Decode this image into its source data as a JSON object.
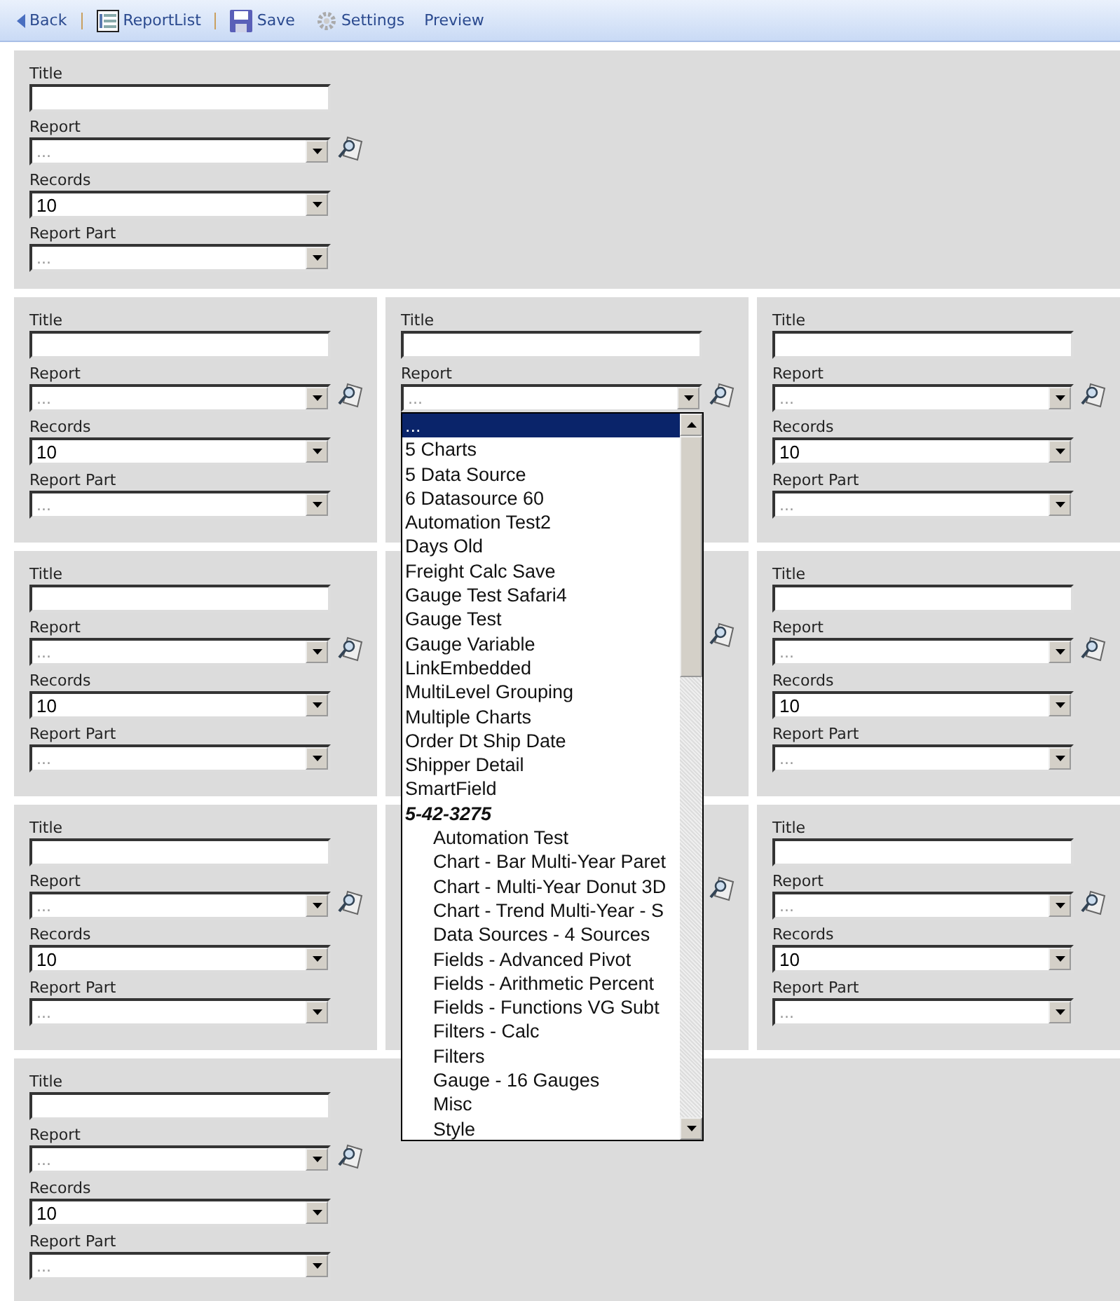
{
  "toolbar": [
    {
      "kind": "back",
      "label": "Back"
    },
    {
      "kind": "list",
      "label": "ReportList"
    },
    {
      "kind": "save",
      "label": "Save"
    },
    {
      "kind": "settings",
      "label": "Settings"
    },
    {
      "kind": "plain",
      "label": "Preview"
    }
  ],
  "rows": [
    {
      "panels": [
        {
          "kind": "form",
          "title_label": "Title",
          "report_label": "Report",
          "report_value": "...",
          "records_label": "Records",
          "records_value": "10",
          "part_label": "Report Part",
          "part_value": "..."
        }
      ]
    },
    {
      "panels": [
        {
          "kind": "form",
          "title_label": "Title",
          "report_label": "Report",
          "report_value": "...",
          "records_label": "Records",
          "records_value": "10",
          "part_label": "Report Part",
          "part_value": "..."
        },
        {
          "kind": "form",
          "title_label": "Title",
          "report_label": "Report",
          "report_value": "...",
          "dropdown": [
            {
              "label": "...",
              "selected": true
            },
            {
              "label": "5 Charts",
              "selected": false
            },
            {
              "label": "5 Data Source",
              "selected": false
            },
            {
              "label": "6 Datasource 60",
              "selected": false
            },
            {
              "label": "Automation Test2",
              "selected": false
            },
            {
              "label": "Days Old",
              "selected": false
            },
            {
              "label": "Freight Calc Save",
              "selected": false
            },
            {
              "label": "Gauge Test Safari4",
              "selected": false
            },
            {
              "label": "Gauge Test",
              "selected": false
            },
            {
              "label": "Gauge Variable",
              "selected": false
            },
            {
              "label": "LinkEmbedded",
              "selected": false
            },
            {
              "label": "MultiLevel Grouping",
              "selected": false
            },
            {
              "label": "Multiple Charts",
              "selected": false
            },
            {
              "label": "Order Dt Ship Date",
              "selected": false
            },
            {
              "label": "Shipper Detail",
              "selected": false
            },
            {
              "label": "SmartField",
              "selected": false
            },
            {
              "label": "5-42-3275",
              "selected": false,
              "children": [
                {
                  "label": "Automation Test",
                  "selected": false
                },
                {
                  "label": "Chart - Bar Multi-Year Paret",
                  "selected": false
                },
                {
                  "label": "Chart - Multi-Year Donut 3D",
                  "selected": false
                },
                {
                  "label": "Chart - Trend Multi-Year - S",
                  "selected": false
                },
                {
                  "label": "Data Sources - 4 Sources",
                  "selected": false
                },
                {
                  "label": "Fields - Advanced Pivot",
                  "selected": false
                },
                {
                  "label": "Fields - Arithmetic Percent",
                  "selected": false
                },
                {
                  "label": "Fields - Functions VG Subt",
                  "selected": false
                },
                {
                  "label": "Filters - Calc",
                  "selected": false
                },
                {
                  "label": "Filters",
                  "selected": false
                },
                {
                  "label": "Gauge - 16 Gauges",
                  "selected": false
                },
                {
                  "label": "Misc",
                  "selected": false
                },
                {
                  "label": "Style",
                  "selected": false
                }
              ]
            }
          ]
        },
        {
          "kind": "form",
          "title_label": "Title",
          "report_label": "Report",
          "report_value": "...",
          "records_label": "Records",
          "records_value": "10",
          "part_label": "Report Part",
          "part_value": "..."
        }
      ]
    },
    {
      "panels": [
        {
          "kind": "form",
          "title_label": "Title",
          "report_label": "Report",
          "report_value": "...",
          "records_label": "Records",
          "records_value": "10",
          "part_label": "Report Part",
          "part_value": "..."
        },
        {
          "kind": "covered"
        },
        {
          "kind": "form",
          "title_label": "Title",
          "report_label": "Report",
          "report_value": "...",
          "records_label": "Records",
          "records_value": "10",
          "part_label": "Report Part",
          "part_value": "..."
        }
      ]
    },
    {
      "panels": [
        {
          "kind": "form",
          "title_label": "Title",
          "report_label": "Report",
          "report_value": "...",
          "records_label": "Records",
          "records_value": "10",
          "part_label": "Report Part",
          "part_value": "..."
        },
        {
          "kind": "covered"
        },
        {
          "kind": "form",
          "title_label": "Title",
          "report_label": "Report",
          "report_value": "...",
          "records_label": "Records",
          "records_value": "10",
          "part_label": "Report Part",
          "part_value": "..."
        }
      ]
    },
    {
      "panels": [
        {
          "kind": "form",
          "title_label": "Title",
          "report_label": "Report",
          "report_value": "...",
          "records_label": "Records",
          "records_value": "10",
          "part_label": "Report Part",
          "part_value": "..."
        }
      ]
    }
  ]
}
